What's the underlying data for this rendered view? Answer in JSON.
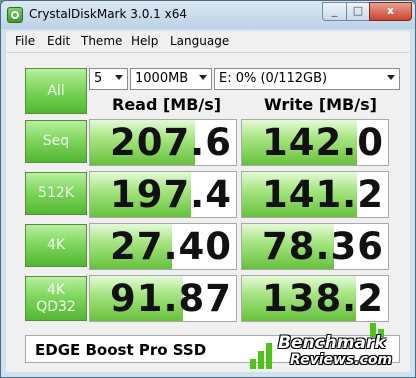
{
  "window": {
    "title": "CrystalDiskMark 3.0.1 x64",
    "min_glyph": "_",
    "max_glyph": "□",
    "close_glyph": "x"
  },
  "menu": [
    "File",
    "Edit",
    "Theme",
    "Help",
    "Language"
  ],
  "controls": {
    "all_label": "All",
    "test_count": "5",
    "test_size": "1000MB",
    "drive": "E: 0% (0/112GB)"
  },
  "columns": {
    "read": "Read [MB/s]",
    "write": "Write [MB/s]"
  },
  "tests": [
    {
      "label": "Seq",
      "read": "207.6",
      "write": "142.0",
      "read_fill": 0.72,
      "write_fill": 0.79
    },
    {
      "label": "512K",
      "read": "197.4",
      "write": "141.2",
      "read_fill": 0.69,
      "write_fill": 0.79
    },
    {
      "label": "4K",
      "read": "27.40",
      "write": "78.36",
      "read_fill": 0.56,
      "write_fill": 0.63
    },
    {
      "label_line1": "4K",
      "label_line2": "QD32",
      "read": "91.87",
      "write": "138.2",
      "read_fill": 0.64,
      "write_fill": 0.78
    }
  ],
  "comment": "EDGE Boost Pro SSD",
  "watermark": {
    "line1": "Benchmark",
    "line2": "Reviews.com",
    "color": "#4fc21c"
  },
  "colors": {
    "button_green": "#7fd75d",
    "bar_green": "#66c13c"
  }
}
